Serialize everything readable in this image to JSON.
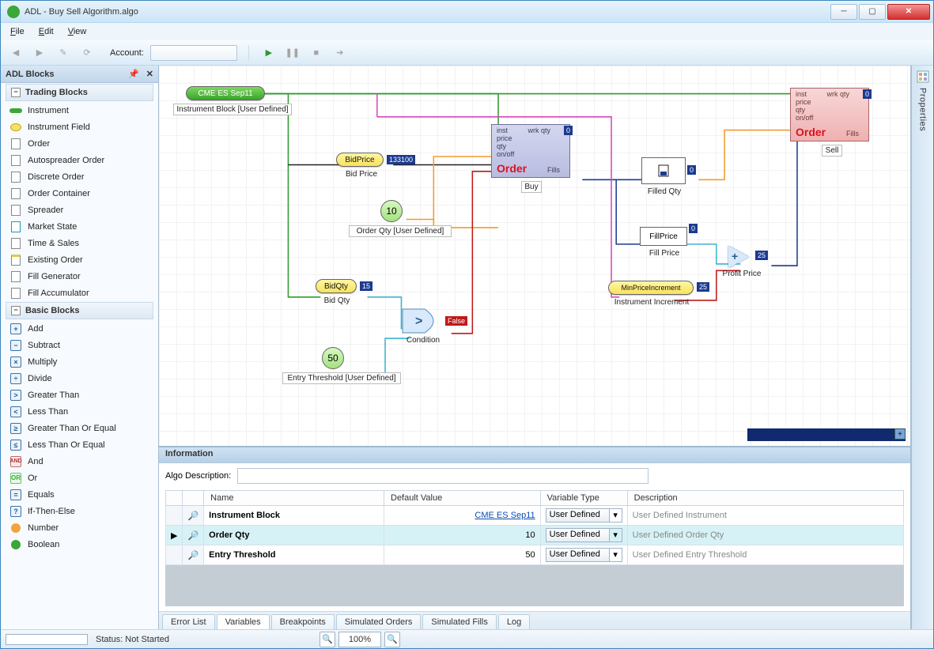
{
  "window": {
    "title": "ADL - Buy Sell Algorithm.algo"
  },
  "menu": {
    "file": "File",
    "edit": "Edit",
    "view": "View"
  },
  "toolbar": {
    "account_label": "Account:"
  },
  "blocks": {
    "title": "ADL Blocks",
    "groups": [
      {
        "title": "Trading Blocks",
        "items": [
          "Instrument",
          "Instrument Field",
          "Order",
          "Autospreader Order",
          "Discrete Order",
          "Order Container",
          "Spreader",
          "Market State",
          "Time & Sales",
          "Existing Order",
          "Fill Generator",
          "Fill Accumulator"
        ]
      },
      {
        "title": "Basic Blocks",
        "items": [
          "Add",
          "Subtract",
          "Multiply",
          "Divide",
          "Greater Than",
          "Less Than",
          "Greater Than Or Equal",
          "Less Than Or Equal",
          "And",
          "Or",
          "Equals",
          "If-Then-Else",
          "Number",
          "Boolean"
        ]
      }
    ]
  },
  "right_panel": {
    "label": "Properties"
  },
  "canvas": {
    "instrument_block": {
      "label": "CME ES Sep11",
      "sub": "Instrument Block [User Defined]"
    },
    "bid_price": {
      "label": "BidPrice",
      "sub": "Bid Price",
      "value": "133100"
    },
    "bid_qty": {
      "label": "BidQty",
      "sub": "Bid Qty",
      "value": "15"
    },
    "order_qty": {
      "label": "10",
      "sub": "Order Qty [User Defined]"
    },
    "entry_threshold": {
      "label": "50",
      "sub": "Entry Threshold [User Defined]"
    },
    "condition": {
      "sub": "Condition",
      "value": "False"
    },
    "order_buy": {
      "title": "Order",
      "inst": "inst",
      "price": "price",
      "qty": "qty",
      "onoff": "on/off",
      "wrkqty": "wrk qty",
      "wrkval": "0",
      "fills": "Fills",
      "sub": "Buy"
    },
    "order_sell": {
      "title": "Order",
      "inst": "inst",
      "price": "price",
      "qty": "qty",
      "onoff": "on/off",
      "wrkqty": "wrk qty",
      "wrkval": "0",
      "fills": "Fills",
      "sub": "Sell"
    },
    "filled_qty": {
      "sub": "Filled Qty",
      "value": "0"
    },
    "fill_price": {
      "label": "FillPrice",
      "sub": "Fill Price",
      "value": "0"
    },
    "min_price": {
      "label": "MinPriceIncrement",
      "sub": "Instrument Increment",
      "value": "25"
    },
    "profit": {
      "sub": "Profit Price",
      "value": "25"
    }
  },
  "info": {
    "title": "Information",
    "algo_label": "Algo Description:",
    "columns": {
      "name": "Name",
      "default": "Default Value",
      "vtype": "Variable Type",
      "desc": "Description"
    },
    "rows": [
      {
        "name": "Instrument Block",
        "default": "CME ES Sep11",
        "vtype": "User Defined",
        "desc": "User Defined Instrument",
        "link": true
      },
      {
        "name": "Order Qty",
        "default": "10",
        "vtype": "User Defined",
        "desc": "User Defined Order Qty",
        "selected": true
      },
      {
        "name": "Entry Threshold",
        "default": "50",
        "vtype": "User Defined",
        "desc": "User Defined Entry Threshold"
      }
    ],
    "tabs": [
      "Error List",
      "Variables",
      "Breakpoints",
      "Simulated Orders",
      "Simulated Fills",
      "Log"
    ],
    "active_tab": 1
  },
  "status": {
    "text": "Status: Not Started",
    "zoom": "100%"
  }
}
